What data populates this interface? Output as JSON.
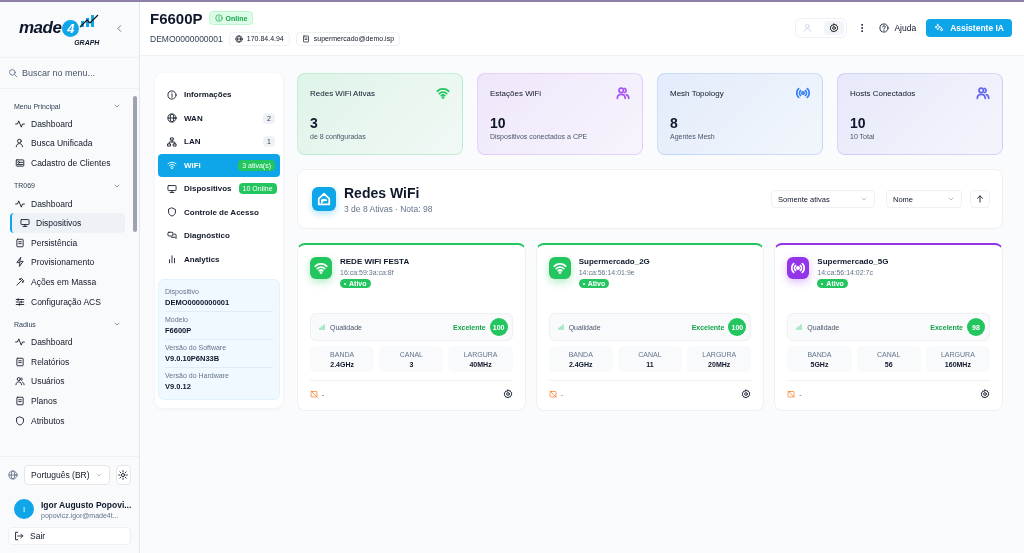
{
  "sidebar": {
    "logo": {
      "word": "made",
      "digit": "4",
      "sub": "GRAPH"
    },
    "search": {
      "placeholder": "Buscar no menu..."
    },
    "groups": [
      {
        "title": "Menu Principal",
        "expanded": true,
        "items": [
          {
            "label": "Dashboard",
            "selected": false
          },
          {
            "label": "Busca Unificada",
            "selected": false
          },
          {
            "label": "Cadastro de Clientes",
            "selected": false
          }
        ]
      },
      {
        "title": "TR069",
        "expanded": true,
        "items": [
          {
            "label": "Dashboard",
            "selected": false
          },
          {
            "label": "Dispositivos",
            "selected": true
          },
          {
            "label": "Persistência",
            "selected": false
          },
          {
            "label": "Provisionamento",
            "selected": false
          },
          {
            "label": "Ações em Massa",
            "selected": false
          },
          {
            "label": "Configuração ACS",
            "selected": false
          }
        ]
      },
      {
        "title": "Radius",
        "expanded": true,
        "items": [
          {
            "label": "Dashboard",
            "selected": false
          },
          {
            "label": "Relatórios",
            "selected": false
          },
          {
            "label": "Usuários",
            "selected": false
          },
          {
            "label": "Planos",
            "selected": false
          },
          {
            "label": "Atributos",
            "selected": false
          }
        ]
      }
    ],
    "language": "Português (BR)",
    "user": {
      "initial": "I",
      "name": "Igor Augusto Popovi...",
      "email": "popovicz.igor@made4t..."
    },
    "logout": "Sair"
  },
  "header": {
    "title": "F6600P",
    "status": "Online",
    "online": true,
    "serial": "DEMO0000000001",
    "ip": "170.84.4.94",
    "email": "supermercado@demo.isp",
    "help": "Ajuda",
    "assistant": "Assistente IA"
  },
  "device_nav": {
    "items": [
      {
        "kind": "plain",
        "label": "Informações",
        "selected": false
      },
      {
        "kind": "count",
        "label": "WAN",
        "badge": "2",
        "selected": false
      },
      {
        "kind": "count",
        "label": "LAN",
        "badge": "1",
        "selected": false
      },
      {
        "kind": "status",
        "label": "WiFi",
        "badge": "3 ativa(s)",
        "selected": true
      },
      {
        "kind": "status",
        "label": "Dispositivos",
        "badge": "10 Online",
        "selected": false
      },
      {
        "kind": "plain",
        "label": "Controle de Acesso",
        "selected": false
      },
      {
        "kind": "plain",
        "label": "Diagnóstico",
        "selected": false
      },
      {
        "kind": "plain",
        "label": "Analytics",
        "selected": false
      }
    ],
    "info": [
      {
        "label": "Dispositivo",
        "value": "DEMO0000000001"
      },
      {
        "label": "Modelo",
        "value": "F6600P"
      },
      {
        "label": "Versão do Software",
        "value": "V9.0.10P6N33B"
      },
      {
        "label": "Versão do Hardware",
        "value": "V9.0.12"
      }
    ]
  },
  "stats": [
    {
      "kind": "wifi",
      "title": "Redes WiFi Ativas",
      "value": "3",
      "caption": "de 8 configuradas",
      "color": "#22c55e"
    },
    {
      "kind": "users",
      "title": "Estações WiFi",
      "value": "10",
      "caption": "Dispositivos conectados a CPE",
      "color": "#a855f7"
    },
    {
      "kind": "mesh",
      "title": "Mesh Topology",
      "value": "8",
      "caption": "Agentes Mesh",
      "color": "#3b82f6"
    },
    {
      "kind": "users",
      "title": "Hosts Conectados",
      "value": "10",
      "caption": "10 Total",
      "color": "#6366f1"
    }
  ],
  "wifi_panel": {
    "title": "Redes WiFi",
    "subtitle": "3 de 8 Ativas · Nota: 98",
    "filter": "Somente ativas",
    "sort": "Nome"
  },
  "networks": [
    {
      "kind": "wifi",
      "name": "REDE WIFI FESTA",
      "mac": "16:ca:59:3a:ca:8f",
      "status": "Ativo",
      "active": true,
      "color": "#22c55e",
      "quality_label": "Qualidade",
      "quality": "Excelente",
      "score": "100",
      "fields": [
        {
          "label": "BANDA",
          "value": "2.4GHz"
        },
        {
          "label": "CANAL",
          "value": "3"
        },
        {
          "label": "LARGURA",
          "value": "40MHz"
        }
      ],
      "footer": "-"
    },
    {
      "kind": "wifi",
      "name": "Supermercado_2G",
      "mac": "14:ca:56:14:01:9e",
      "status": "Ativo",
      "active": true,
      "color": "#22c55e",
      "quality_label": "Qualidade",
      "quality": "Excelente",
      "score": "100",
      "fields": [
        {
          "label": "BANDA",
          "value": "2.4GHz"
        },
        {
          "label": "CANAL",
          "value": "11"
        },
        {
          "label": "LARGURA",
          "value": "20MHz"
        }
      ],
      "footer": "-"
    },
    {
      "kind": "mesh",
      "name": "Supermercado_5G",
      "mac": "14:ca:56:14:02:7c",
      "status": "Ativo",
      "active": true,
      "color": "#9333ea",
      "quality_label": "Qualidade",
      "quality": "Excelente",
      "score": "98",
      "fields": [
        {
          "label": "BANDA",
          "value": "5GHz"
        },
        {
          "label": "CANAL",
          "value": "56"
        },
        {
          "label": "LARGURA",
          "value": "160MHz"
        }
      ],
      "footer": "-"
    }
  ]
}
